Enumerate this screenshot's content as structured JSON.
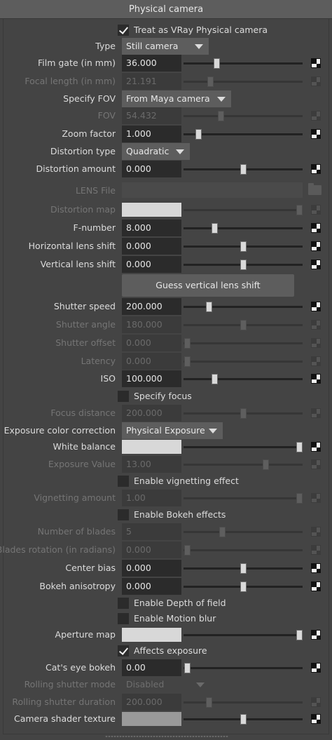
{
  "header": {
    "title": "Physical camera"
  },
  "treat_as_vray": {
    "label": "Treat as VRay Physical camera",
    "checked": true
  },
  "type": {
    "label": "Type",
    "value": "Still camera"
  },
  "film_gate": {
    "label": "Film gate (in mm)",
    "value": "36.000"
  },
  "focal_length": {
    "label": "Focal length (in mm)",
    "value": "21.191"
  },
  "specify_fov": {
    "label": "Specify FOV",
    "value": "From Maya camera"
  },
  "fov": {
    "label": "FOV",
    "value": "54.432"
  },
  "zoom_factor": {
    "label": "Zoom factor",
    "value": "1.000"
  },
  "distortion_type": {
    "label": "Distortion type",
    "value": "Quadratic"
  },
  "distortion_amount": {
    "label": "Distortion amount",
    "value": "0.000"
  },
  "lens_file": {
    "label": "LENS File",
    "value": ""
  },
  "distortion_map": {
    "label": "Distortion map"
  },
  "f_number": {
    "label": "F-number",
    "value": "8.000"
  },
  "horizontal_lens_shift": {
    "label": "Horizontal lens shift",
    "value": "0.000"
  },
  "vertical_lens_shift": {
    "label": "Vertical lens shift",
    "value": "0.000"
  },
  "guess_button": {
    "label": "Guess vertical lens shift"
  },
  "shutter_speed": {
    "label": "Shutter speed",
    "value": "200.000"
  },
  "shutter_angle": {
    "label": "Shutter angle",
    "value": "180.000"
  },
  "shutter_offset": {
    "label": "Shutter offset",
    "value": "0.000"
  },
  "latency": {
    "label": "Latency",
    "value": "0.000"
  },
  "iso": {
    "label": "ISO",
    "value": "100.000"
  },
  "specify_focus": {
    "label": "Specify focus",
    "checked": false
  },
  "focus_distance": {
    "label": "Focus distance",
    "value": "200.000"
  },
  "exposure_color_correction": {
    "label": "Exposure color correction",
    "value": "Physical Exposure"
  },
  "white_balance": {
    "label": "White balance"
  },
  "exposure_value": {
    "label": "Exposure Value",
    "value": "13.00"
  },
  "enable_vignetting": {
    "label": "Enable vignetting effect",
    "checked": false
  },
  "vignetting_amount": {
    "label": "Vignetting amount",
    "value": "1.00"
  },
  "enable_bokeh": {
    "label": "Enable Bokeh effects",
    "checked": false
  },
  "number_of_blades": {
    "label": "Number of blades",
    "value": "5"
  },
  "blades_rotation": {
    "label": "Blades rotation (in radians)",
    "value": "0.000"
  },
  "center_bias": {
    "label": "Center bias",
    "value": "0.000"
  },
  "bokeh_anisotropy": {
    "label": "Bokeh anisotropy",
    "value": "0.000"
  },
  "enable_dof": {
    "label": "Enable Depth of field",
    "checked": false
  },
  "enable_motion_blur": {
    "label": "Enable Motion blur",
    "checked": false
  },
  "aperture_map": {
    "label": "Aperture map"
  },
  "affects_exposure": {
    "label": "Affects exposure",
    "checked": true
  },
  "cats_eye_bokeh": {
    "label": "Cat's eye bokeh",
    "value": "0.00"
  },
  "rolling_shutter_mode": {
    "label": "Rolling shutter mode",
    "value": "Disabled"
  },
  "rolling_shutter_duration": {
    "label": "Rolling shutter duration",
    "value": "200.000"
  },
  "camera_shader_texture": {
    "label": "Camera shader texture"
  },
  "colors": {
    "panel_bg": "#444444",
    "header_bg": "#5d5d5d",
    "field_bg": "#2b2b2b",
    "dropdown_bg": "#5d5d5d",
    "disabled_text": "#757575",
    "swatch": "#d8d8d8"
  },
  "icons": {
    "map_button": "checker-map-icon",
    "browse": "folder-icon",
    "dropdown": "chevron-down-icon",
    "checkbox": "checkmark-icon"
  }
}
